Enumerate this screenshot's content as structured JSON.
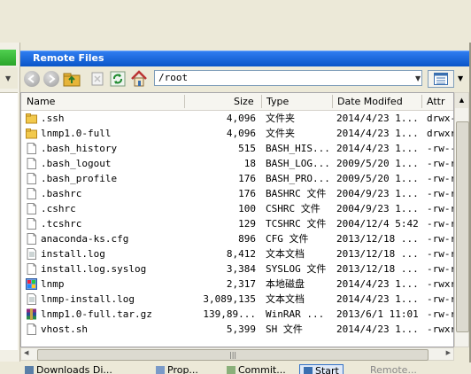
{
  "remote_panel": {
    "title": "Remote Files",
    "path": "/root",
    "header_color": "#0a55c8"
  },
  "columns": [
    {
      "label": "Name"
    },
    {
      "label": "Size"
    },
    {
      "label": "Type"
    },
    {
      "label": "Date Modifed"
    },
    {
      "label": "Attr"
    }
  ],
  "files": [
    {
      "name": ".ssh",
      "size": "4,096",
      "type": "文件夹",
      "date": "2014/4/23 1...",
      "attr": "drwx-",
      "icon": "folder-icon"
    },
    {
      "name": "lnmp1.0-full",
      "size": "4,096",
      "type": "文件夹",
      "date": "2014/4/23 1...",
      "attr": "drwxr",
      "icon": "folder-icon"
    },
    {
      "name": ".bash_history",
      "size": "515",
      "type": "BASH_HIS...",
      "date": "2014/4/23 1...",
      "attr": "-rw--",
      "icon": "file-icon"
    },
    {
      "name": ".bash_logout",
      "size": "18",
      "type": "BASH_LOG...",
      "date": "2009/5/20 1...",
      "attr": "-rw-r",
      "icon": "file-icon"
    },
    {
      "name": ".bash_profile",
      "size": "176",
      "type": "BASH_PRO...",
      "date": "2009/5/20 1...",
      "attr": "-rw-r",
      "icon": "file-icon"
    },
    {
      "name": ".bashrc",
      "size": "176",
      "type": "BASHRC 文件",
      "date": "2004/9/23 1...",
      "attr": "-rw-r",
      "icon": "file-icon"
    },
    {
      "name": ".cshrc",
      "size": "100",
      "type": "CSHRC 文件",
      "date": "2004/9/23 1...",
      "attr": "-rw-r",
      "icon": "file-icon"
    },
    {
      "name": ".tcshrc",
      "size": "129",
      "type": "TCSHRC 文件",
      "date": "2004/12/4 5:42",
      "attr": "-rw-r",
      "icon": "file-icon"
    },
    {
      "name": "anaconda-ks.cfg",
      "size": "896",
      "type": "CFG 文件",
      "date": "2013/12/18 ...",
      "attr": "-rw-r",
      "icon": "file-icon"
    },
    {
      "name": "install.log",
      "size": "8,412",
      "type": "文本文档",
      "date": "2013/12/18 ...",
      "attr": "-rw-r",
      "icon": "text-file-icon"
    },
    {
      "name": "install.log.syslog",
      "size": "3,384",
      "type": "SYSLOG 文件",
      "date": "2013/12/18 ...",
      "attr": "-rw-r",
      "icon": "file-icon"
    },
    {
      "name": "lnmp",
      "size": "2,317",
      "type": "本地磁盘",
      "date": "2014/4/23 1...",
      "attr": "-rwxr",
      "icon": "drive-icon"
    },
    {
      "name": "lnmp-install.log",
      "size": "3,089,135",
      "type": "文本文档",
      "date": "2014/4/23 1...",
      "attr": "-rw-r",
      "icon": "text-file-icon"
    },
    {
      "name": "lnmp1.0-full.tar.gz",
      "size": "139,89...",
      "type": "WinRAR ...",
      "date": "2013/6/1 11:01",
      "attr": "-rw-r",
      "icon": "winrar-archive-icon"
    },
    {
      "name": "vhost.sh",
      "size": "5,399",
      "type": "SH 文件",
      "date": "2014/4/23 1...",
      "attr": "-rwxr",
      "icon": "file-icon"
    }
  ],
  "bottom_tabs": [
    {
      "label": "Downloads Di..."
    },
    {
      "label": "Prop..."
    },
    {
      "label": "Commit..."
    },
    {
      "label": "Start"
    },
    {
      "label": "Remote..."
    }
  ]
}
